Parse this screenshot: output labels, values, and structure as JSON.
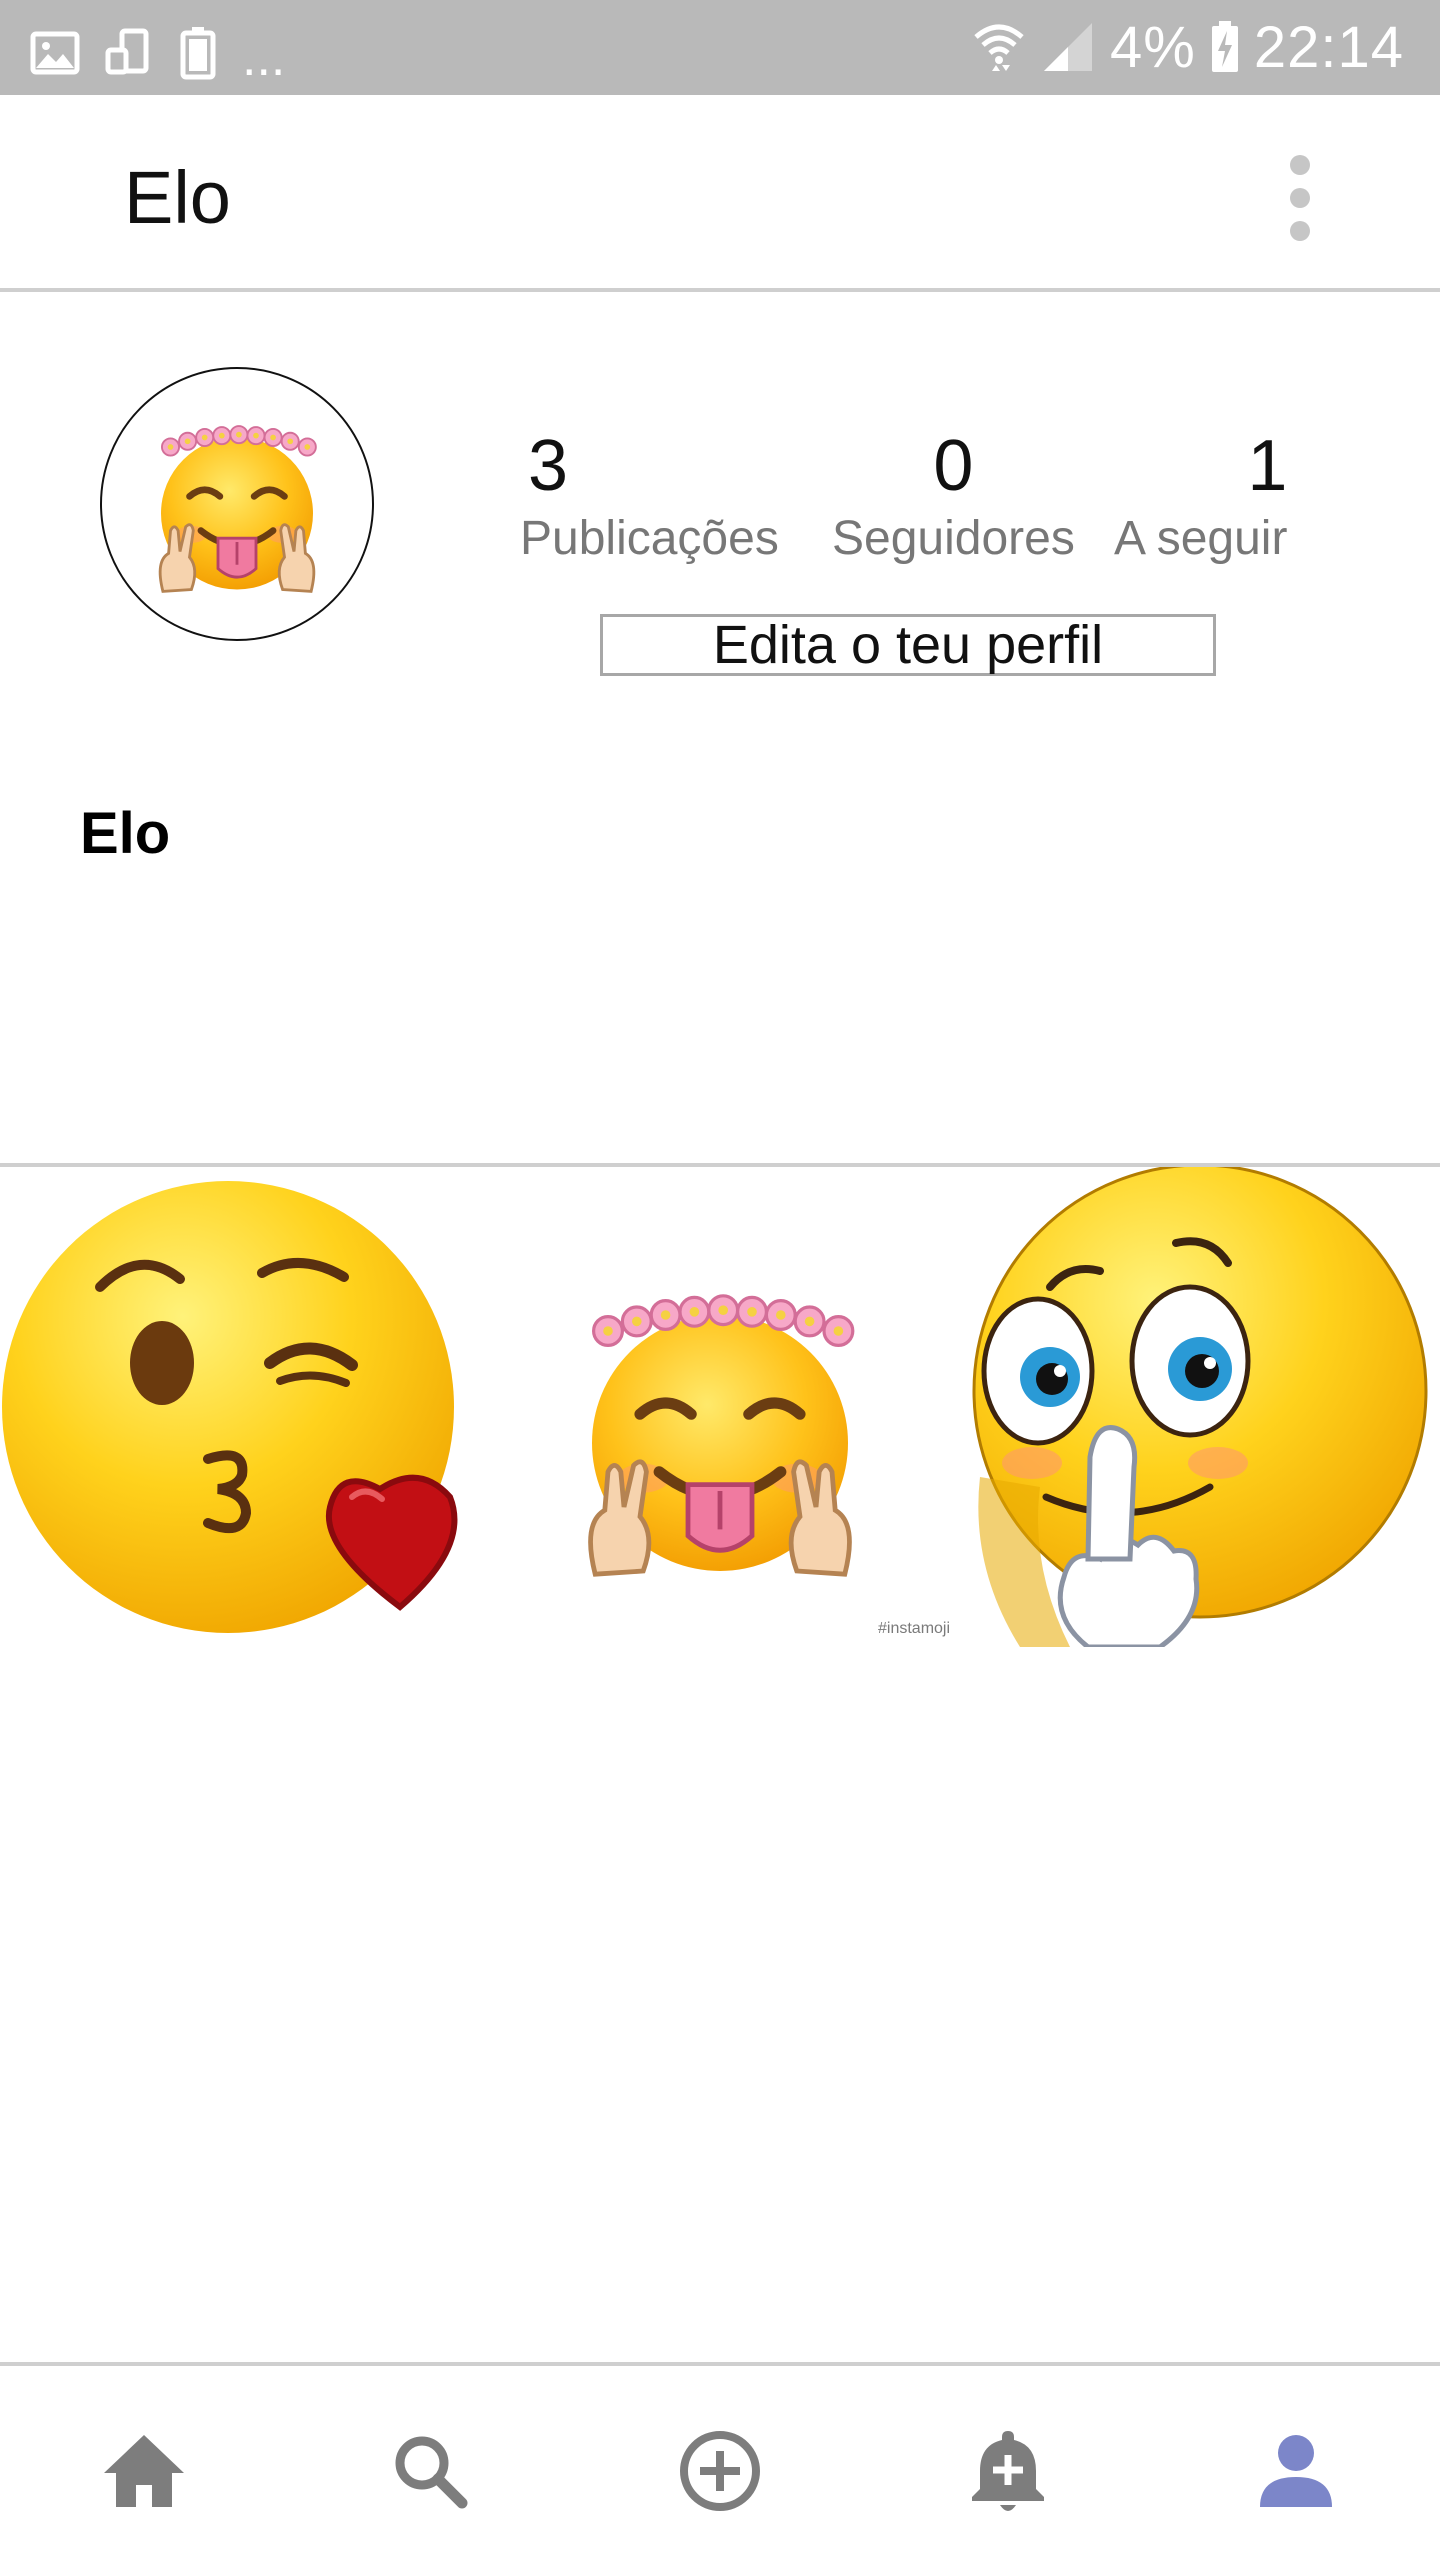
{
  "status_bar": {
    "left_icons": [
      "image-icon",
      "screen-mirror-icon",
      "battery-saver-icon"
    ],
    "overflow": "...",
    "battery_percent": "4%",
    "time": "22:14",
    "icon_color": "#ffffff",
    "background": "#b9b9b9"
  },
  "appbar": {
    "title": "Elo",
    "menu_icon": "more-vert-icon"
  },
  "profile": {
    "avatar_icon": "flower-crown-peace-emoji",
    "stats": [
      {
        "count": "3",
        "label": "Publicações"
      },
      {
        "count": "0",
        "label": "Seguidores"
      },
      {
        "count": "1",
        "label": "A seguir"
      }
    ],
    "edit_button": "Edita o teu perfil",
    "name": "Elo"
  },
  "posts": [
    {
      "icon": "kiss-heart-emoji"
    },
    {
      "icon": "flower-crown-peace-emoji",
      "watermark": "#instamoji"
    },
    {
      "icon": "shush-thumb-emoji"
    }
  ],
  "bottom_nav": {
    "items": [
      {
        "icon": "home-icon",
        "active": false
      },
      {
        "icon": "search-icon",
        "active": false
      },
      {
        "icon": "add-circle-icon",
        "active": false
      },
      {
        "icon": "notification-add-icon",
        "active": false
      },
      {
        "icon": "profile-icon",
        "active": true
      }
    ],
    "inactive_color": "#7d7d7d",
    "active_color": "#7c86c9"
  }
}
